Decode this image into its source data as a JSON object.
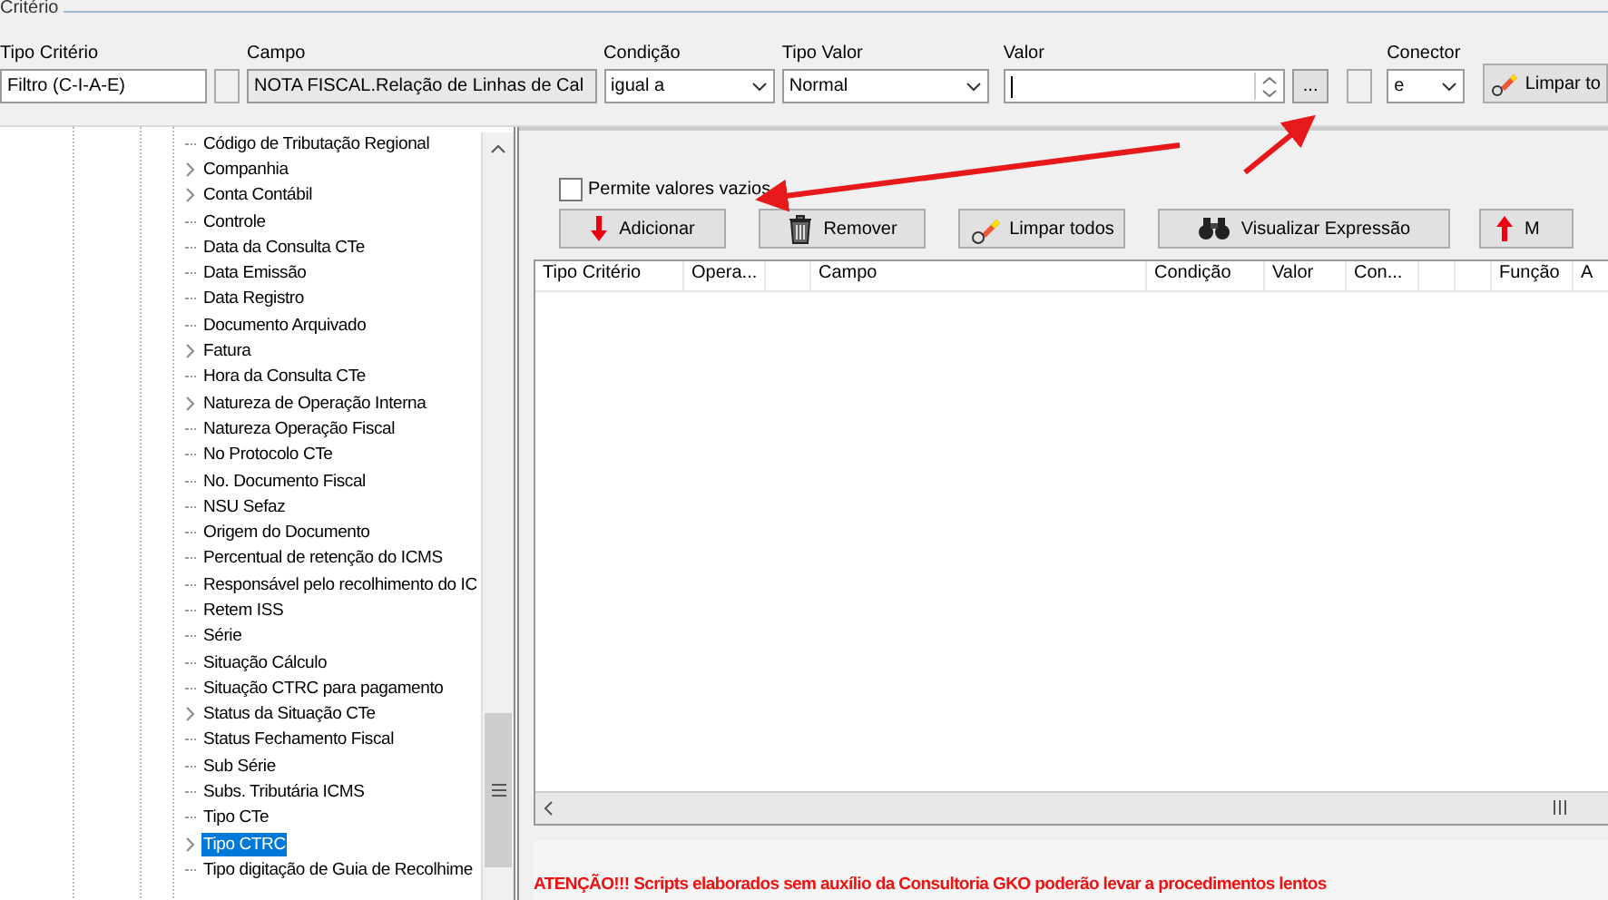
{
  "criteria": {
    "title": "Critério",
    "tipo_criterio": {
      "label": "Tipo Critério",
      "value": "Filtro (C-I-A-E)"
    },
    "check_1": {
      "checked": false
    },
    "campo": {
      "label": "Campo",
      "value": "NOTA FISCAL.Relação de Linhas de Cal"
    },
    "condicao": {
      "label": "Condição",
      "value": "igual a"
    },
    "tipo_valor": {
      "label": "Tipo Valor",
      "value": "Normal"
    },
    "valor": {
      "label": "Valor",
      "button": "..."
    },
    "check_2": {
      "checked": false
    },
    "conector": {
      "label": "Conector",
      "value": "e"
    },
    "clear_button": "Limpar to"
  },
  "tree": [
    {
      "label": "Código de Tributação Regional",
      "expandable": false,
      "selected": false
    },
    {
      "label": "Companhia",
      "expandable": true,
      "selected": false
    },
    {
      "label": "Conta Contábil",
      "expandable": true,
      "selected": false
    },
    {
      "label": "Controle",
      "expandable": false,
      "selected": false
    },
    {
      "label": "Data da Consulta CTe",
      "expandable": false,
      "selected": false
    },
    {
      "label": "Data Emissão",
      "expandable": false,
      "selected": false
    },
    {
      "label": "Data Registro",
      "expandable": false,
      "selected": false
    },
    {
      "label": "Documento Arquivado",
      "expandable": false,
      "selected": false
    },
    {
      "label": "Fatura",
      "expandable": true,
      "selected": false
    },
    {
      "label": "Hora da Consulta CTe",
      "expandable": false,
      "selected": false
    },
    {
      "label": "Natureza de Operação Interna",
      "expandable": true,
      "selected": false
    },
    {
      "label": "Natureza Operação Fiscal",
      "expandable": false,
      "selected": false
    },
    {
      "label": "No Protocolo CTe",
      "expandable": false,
      "selected": false
    },
    {
      "label": "No. Documento Fiscal",
      "expandable": false,
      "selected": false
    },
    {
      "label": "NSU Sefaz",
      "expandable": false,
      "selected": false
    },
    {
      "label": "Origem do Documento",
      "expandable": false,
      "selected": false
    },
    {
      "label": "Percentual de retenção do ICMS",
      "expandable": false,
      "selected": false
    },
    {
      "label": "Responsável pelo recolhimento do IC",
      "expandable": false,
      "selected": false
    },
    {
      "label": "Retem ISS",
      "expandable": false,
      "selected": false
    },
    {
      "label": "Série",
      "expandable": false,
      "selected": false
    },
    {
      "label": "Situação Cálculo",
      "expandable": false,
      "selected": false
    },
    {
      "label": "Situação CTRC para pagamento",
      "expandable": false,
      "selected": false
    },
    {
      "label": "Status da Situação CTe",
      "expandable": true,
      "selected": false
    },
    {
      "label": "Status Fechamento Fiscal",
      "expandable": false,
      "selected": false
    },
    {
      "label": "Sub Série",
      "expandable": false,
      "selected": false
    },
    {
      "label": "Subs. Tributária ICMS",
      "expandable": false,
      "selected": false
    },
    {
      "label": "Tipo CTe",
      "expandable": false,
      "selected": false
    },
    {
      "label": "Tipo CTRC",
      "expandable": true,
      "selected": true
    },
    {
      "label": "Tipo digitação de Guia de Recolhime",
      "expandable": false,
      "selected": false
    }
  ],
  "allow_empty": {
    "label": "Permite valores vazios",
    "checked": false
  },
  "actions": [
    {
      "kind": "add",
      "label": "Adicionar"
    },
    {
      "kind": "remove",
      "label": "Remover"
    },
    {
      "kind": "clear",
      "label": "Limpar todos"
    },
    {
      "kind": "view",
      "label": "Visualizar Expressão"
    },
    {
      "kind": "up",
      "label": "M"
    }
  ],
  "grid": {
    "columns": [
      "Tipo Critério",
      "Opera...",
      "",
      "Campo",
      "Condição",
      "Valor",
      "Con...",
      "",
      "",
      "Função",
      "A"
    ]
  },
  "warning": "ATENÇÃO!!! Scripts elaborados sem auxílio da Consultoria GKO poderão levar a procedimentos lentos"
}
